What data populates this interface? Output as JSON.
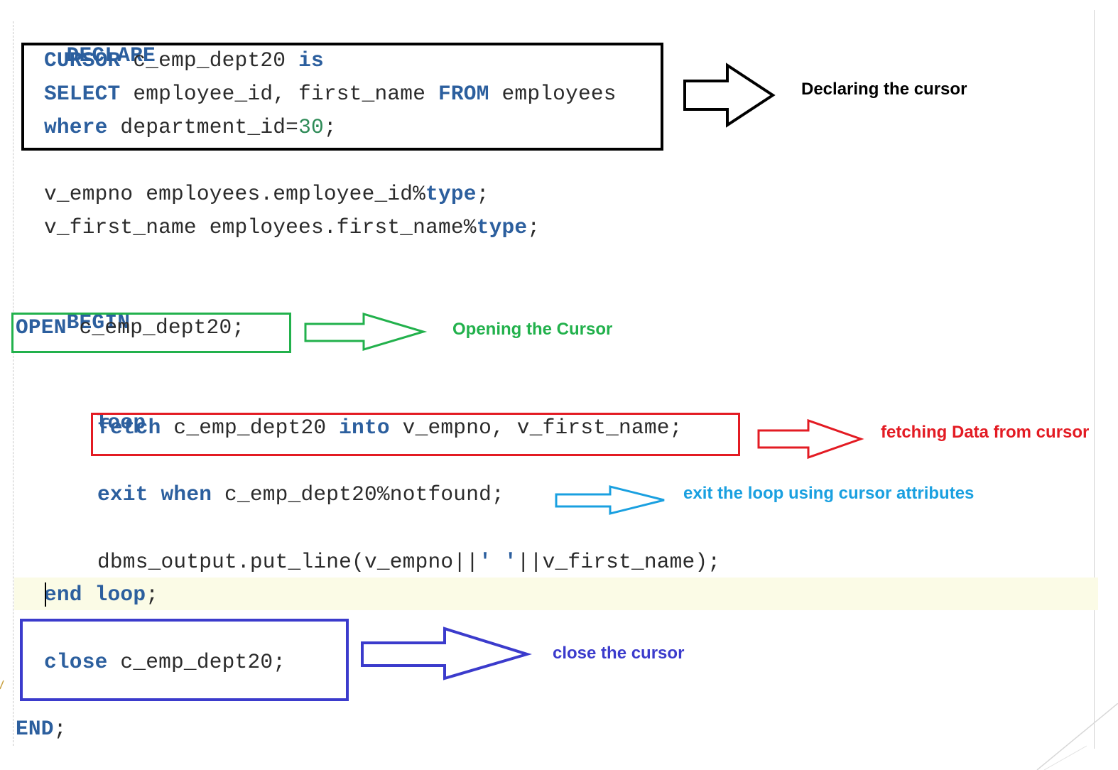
{
  "code": {
    "declare": "DECLARE",
    "cursor_kw": "CURSOR",
    "cursor_name": " c_emp_dept20 ",
    "is_kw": "is",
    "select_kw": "SELECT",
    "select_cols": " employee_id, first_name ",
    "from_kw": "FROM",
    "from_table": " employees",
    "where_kw": "where",
    "where_cond": " department_id=",
    "where_value": "30",
    "semicolon": ";",
    "v_empno_decl": "v_empno employees.employee_id%",
    "type_kw": "type",
    "v_first_name_decl": "v_first_name employees.first_name%",
    "begin": "BEGIN",
    "open_kw": "OPEN",
    "open_rest": " c_emp_dept20;",
    "loop_kw": "loop",
    "fetch_kw": "fetch",
    "fetch_cursor": " c_emp_dept20 ",
    "into_kw": "into",
    "fetch_vars": " v_empno, v_first_name;",
    "exit_kw": "exit",
    "when_kw": "when",
    "exit_cond": " c_emp_dept20%notfound;",
    "dbms_call_start": "dbms_output.put_line(v_empno||",
    "dbms_string": "' '",
    "dbms_call_end": "||v_first_name);",
    "end_kw": "end",
    "end_loop_kw": "loop",
    "close_kw": "close",
    "close_rest": " c_emp_dept20;",
    "end_block": "END",
    "end_block_semicolon": ";"
  },
  "annotations": {
    "declare_label": "Declaring the cursor",
    "open_label": "Opening the Cursor",
    "fetch_label": "fetching Data from cursor",
    "exit_label": "exit the loop using cursor attributes",
    "close_label": "close the cursor"
  },
  "colors": {
    "declare": "#000000",
    "open": "#22b14c",
    "fetch": "#e31b23",
    "exit": "#1aa0e0",
    "close": "#3b3bcc",
    "keyword": "#2c5f9e",
    "number": "#2e8b57",
    "current_line": "#fbfbe6"
  }
}
